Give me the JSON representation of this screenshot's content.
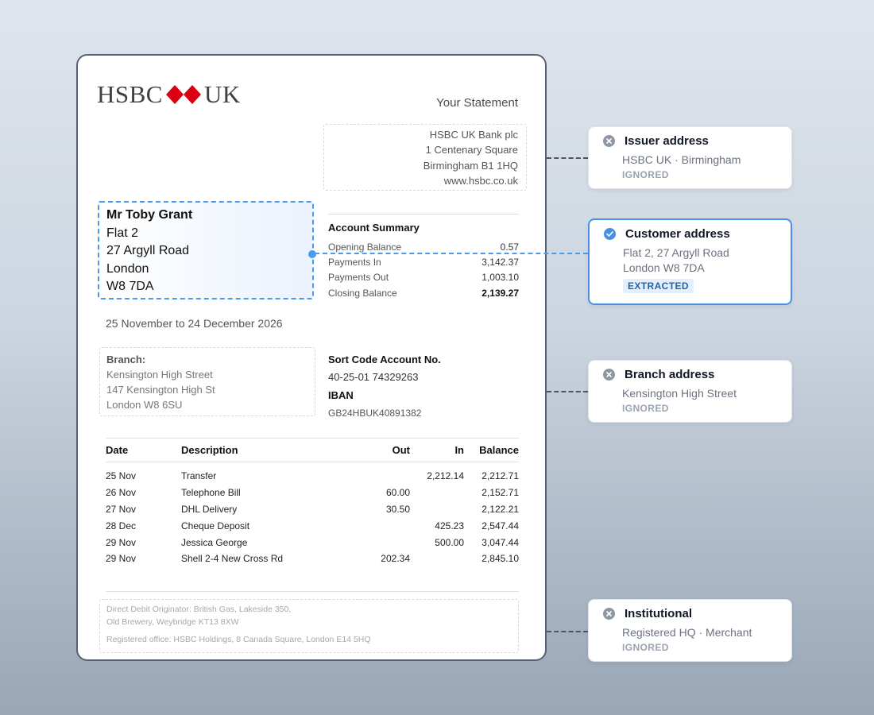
{
  "statement": {
    "bank_name_left": "HSBC",
    "bank_name_right": "UK",
    "logo_red": "#db0011",
    "title": "Your Statement",
    "issuer_lines": [
      "HSBC UK Bank plc",
      "1 Centenary Square",
      "Birmingham B1 1HQ",
      "www.hsbc.co.uk"
    ],
    "customer": {
      "name": "Mr Toby Grant",
      "lines": [
        "Flat 2",
        "27 Argyll Road",
        "London",
        "W8 7DA"
      ]
    },
    "summary": {
      "heading": "Account Summary",
      "rows": [
        {
          "label": "Opening Balance",
          "value": "0.57"
        },
        {
          "label": "Payments In",
          "value": "3,142.37"
        },
        {
          "label": "Payments Out",
          "value": "1,003.10"
        },
        {
          "label": "Closing Balance",
          "value": "2,139.27"
        }
      ]
    },
    "period": "25 November to 24 December 2026",
    "branch": {
      "heading": "Branch:",
      "lines": [
        "Kensington High Street",
        "147 Kensington High St",
        "London W8 6SU"
      ]
    },
    "account": {
      "sort_label": "Sort Code Account No.",
      "sort_value": "40-25-01 74329263",
      "iban_label": "IBAN",
      "iban_value": "GB24HBUK40891382"
    },
    "table": {
      "headers": [
        "Date",
        "Description",
        "Out",
        "In",
        "Balance"
      ],
      "rows": [
        [
          "25 Nov",
          "Transfer",
          "",
          "2,212.14",
          "2,212.71"
        ],
        [
          "26 Nov",
          "Telephone Bill",
          "60.00",
          "",
          "2,152.71"
        ],
        [
          "27 Nov",
          "DHL Delivery",
          "30.50",
          "",
          "2,122.21"
        ],
        [
          "28 Dec",
          "Cheque Deposit",
          "",
          "425.23",
          "2,547.44"
        ],
        [
          "29 Nov",
          "Jessica George",
          "",
          "500.00",
          "3,047.44"
        ],
        [
          "29 Nov",
          "Shell 2-4 New Cross Rd",
          "202.34",
          "",
          "2,845.10"
        ]
      ]
    },
    "footer": {
      "lines": [
        "Direct Debit Originator: British Gas, Lakeside 350,",
        "Old Brewery, Weybridge KT13 8XW"
      ],
      "registered": "Registered office: HSBC Holdings, 8 Canada Square, London E14 5HQ"
    }
  },
  "cards": [
    {
      "title": "Issuer address",
      "lines": [
        "HSBC UK · Birmingham"
      ],
      "status": "IGNORED",
      "icon": "x-circle-icon"
    },
    {
      "title": "Customer address",
      "lines": [
        "Flat 2, 27 Argyll Road",
        "London W8 7DA"
      ],
      "status": "EXTRACTED",
      "icon": "check-circle-icon"
    },
    {
      "title": "Branch address",
      "lines": [
        "Kensington High Street"
      ],
      "status": "IGNORED",
      "icon": "x-circle-icon"
    },
    {
      "title": "Institutional",
      "lines": [
        "Registered HQ · Merchant"
      ],
      "status": "IGNORED",
      "icon": "x-circle-icon"
    }
  ],
  "colors": {
    "accent": "#4a90e2",
    "ignored": "#8d96a3",
    "connector": "#4b5563"
  }
}
